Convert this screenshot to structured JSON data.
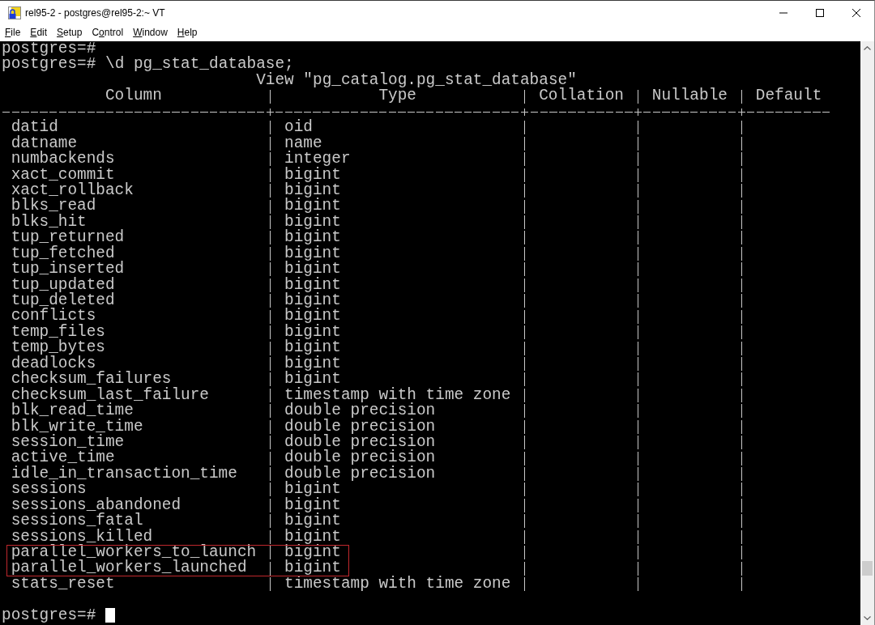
{
  "window": {
    "title": "rel95-2 - postgres@rel95-2:~ VT"
  },
  "menu": [
    {
      "key": "F",
      "after": "ile"
    },
    {
      "key": "E",
      "after": "dit"
    },
    {
      "key": "S",
      "after": "etup"
    },
    {
      "before": "C",
      "key": "o",
      "after": "ntrol"
    },
    {
      "key": "W",
      "after": "indow"
    },
    {
      "key": "H",
      "after": "elp"
    }
  ],
  "terminal": {
    "history": [
      "postgres=#",
      "postgres=# \\d pg_stat_database;"
    ],
    "table": {
      "title": "View \"pg_catalog.pg_stat_database\"",
      "columns": [
        "Column",
        "Type",
        "Collation",
        "Nullable",
        "Default"
      ],
      "rows": [
        {
          "column": "datid",
          "type": "oid",
          "highlighted": false
        },
        {
          "column": "datname",
          "type": "name",
          "highlighted": false
        },
        {
          "column": "numbackends",
          "type": "integer",
          "highlighted": false
        },
        {
          "column": "xact_commit",
          "type": "bigint",
          "highlighted": false
        },
        {
          "column": "xact_rollback",
          "type": "bigint",
          "highlighted": false
        },
        {
          "column": "blks_read",
          "type": "bigint",
          "highlighted": false
        },
        {
          "column": "blks_hit",
          "type": "bigint",
          "highlighted": false
        },
        {
          "column": "tup_returned",
          "type": "bigint",
          "highlighted": false
        },
        {
          "column": "tup_fetched",
          "type": "bigint",
          "highlighted": false
        },
        {
          "column": "tup_inserted",
          "type": "bigint",
          "highlighted": false
        },
        {
          "column": "tup_updated",
          "type": "bigint",
          "highlighted": false
        },
        {
          "column": "tup_deleted",
          "type": "bigint",
          "highlighted": false
        },
        {
          "column": "conflicts",
          "type": "bigint",
          "highlighted": false
        },
        {
          "column": "temp_files",
          "type": "bigint",
          "highlighted": false
        },
        {
          "column": "temp_bytes",
          "type": "bigint",
          "highlighted": false
        },
        {
          "column": "deadlocks",
          "type": "bigint",
          "highlighted": false
        },
        {
          "column": "checksum_failures",
          "type": "bigint",
          "highlighted": false
        },
        {
          "column": "checksum_last_failure",
          "type": "timestamp with time zone",
          "highlighted": false
        },
        {
          "column": "blk_read_time",
          "type": "double precision",
          "highlighted": false
        },
        {
          "column": "blk_write_time",
          "type": "double precision",
          "highlighted": false
        },
        {
          "column": "session_time",
          "type": "double precision",
          "highlighted": false
        },
        {
          "column": "active_time",
          "type": "double precision",
          "highlighted": false
        },
        {
          "column": "idle_in_transaction_time",
          "type": "double precision",
          "highlighted": false
        },
        {
          "column": "sessions",
          "type": "bigint",
          "highlighted": false
        },
        {
          "column": "sessions_abandoned",
          "type": "bigint",
          "highlighted": false
        },
        {
          "column": "sessions_fatal",
          "type": "bigint",
          "highlighted": false
        },
        {
          "column": "sessions_killed",
          "type": "bigint",
          "highlighted": false
        },
        {
          "column": "parallel_workers_to_launch",
          "type": "bigint",
          "highlighted": true
        },
        {
          "column": "parallel_workers_launched",
          "type": "bigint",
          "highlighted": true
        },
        {
          "column": "stats_reset",
          "type": "timestamp with time zone",
          "highlighted": false
        }
      ]
    },
    "prompt": "postgres=#",
    "cursor": true
  }
}
